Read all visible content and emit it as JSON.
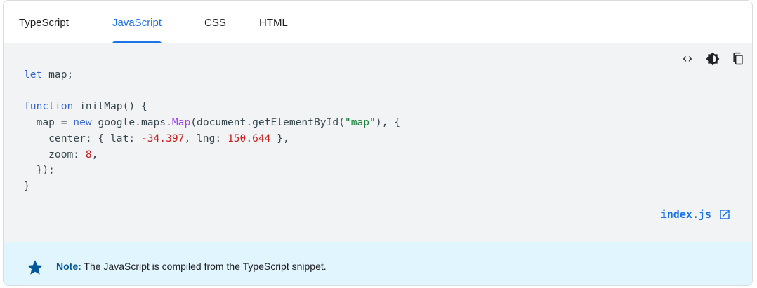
{
  "tabs": [
    {
      "label": "TypeScript",
      "active": false
    },
    {
      "label": "JavaScript",
      "active": true
    },
    {
      "label": "CSS",
      "active": false
    },
    {
      "label": "HTML",
      "active": false
    }
  ],
  "toolbar": {
    "icons": [
      "code-view-icon",
      "dark-mode-icon",
      "copy-icon"
    ]
  },
  "code": {
    "language": "javascript",
    "lines": [
      "let map;",
      "",
      "function initMap() {",
      "  map = new google.maps.Map(document.getElementById(\"map\"), {",
      "    center: { lat: -34.397, lng: 150.644 },",
      "    zoom: 8,",
      "  });",
      "}"
    ]
  },
  "file_link": {
    "name": "index.js",
    "icon": "open-in-new-icon"
  },
  "note": {
    "icon": "star-icon",
    "label": "Note:",
    "text": " The JavaScript is compiled from the TypeScript snippet."
  },
  "colors": {
    "accent": "#1a73e8",
    "keyword": "#3367d6",
    "function": "#a142f4",
    "string": "#188038",
    "number": "#c5221f",
    "code_background": "#f1f3f4",
    "note_background": "#e1f5fe",
    "note_accent": "#01579b"
  }
}
